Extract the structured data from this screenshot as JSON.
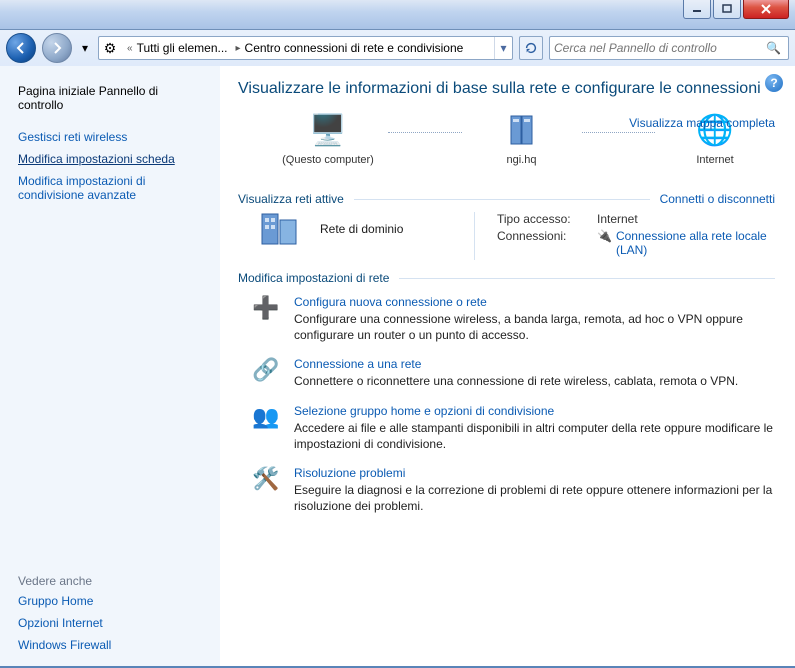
{
  "breadcrumb": {
    "prefix": "«",
    "item1": "Tutti gli elemen...",
    "item2": "Centro connessioni di rete e condivisione"
  },
  "search": {
    "placeholder": "Cerca nel Pannello di controllo"
  },
  "sidebar": {
    "header": "Pagina iniziale Pannello di\ncontrollo",
    "links": [
      "Gestisci reti wireless",
      "Modifica impostazioni scheda",
      "Modifica impostazioni di\ncondivisione avanzate"
    ],
    "seealso_label": "Vedere anche",
    "seealso": [
      "Gruppo Home",
      "Opzioni Internet",
      "Windows Firewall"
    ]
  },
  "main": {
    "heading": "Visualizzare le informazioni di base sulla rete e configurare le connessioni",
    "map_full_link": "Visualizza mappa completa",
    "nodes": {
      "this_computer": "(Questo computer)",
      "ngi": "ngi.hq",
      "internet": "Internet"
    },
    "active_header": "Visualizza reti attive",
    "active_right": "Connetti o disconnetti",
    "network": {
      "name": "Rete di dominio",
      "access_label": "Tipo accesso:",
      "access_value": "Internet",
      "conn_label": "Connessioni:",
      "conn_value": "Connessione alla rete locale (LAN)"
    },
    "modify_header": "Modifica impostazioni di rete",
    "tasks": [
      {
        "title": "Configura nuova connessione o rete",
        "desc": "Configurare una connessione wireless, a banda larga, remota, ad hoc o VPN oppure configurare un router o un punto di accesso."
      },
      {
        "title": "Connessione a una rete",
        "desc": "Connettere o riconnettere una connessione di rete wireless, cablata, remota o VPN."
      },
      {
        "title": "Selezione gruppo home e opzioni di condivisione",
        "desc": "Accedere ai file e alle stampanti disponibili in altri computer della rete oppure modificare le impostazioni di condivisione."
      },
      {
        "title": "Risoluzione problemi",
        "desc": "Eseguire la diagnosi e la correzione di problemi di rete oppure ottenere informazioni per la risoluzione dei problemi."
      }
    ]
  }
}
